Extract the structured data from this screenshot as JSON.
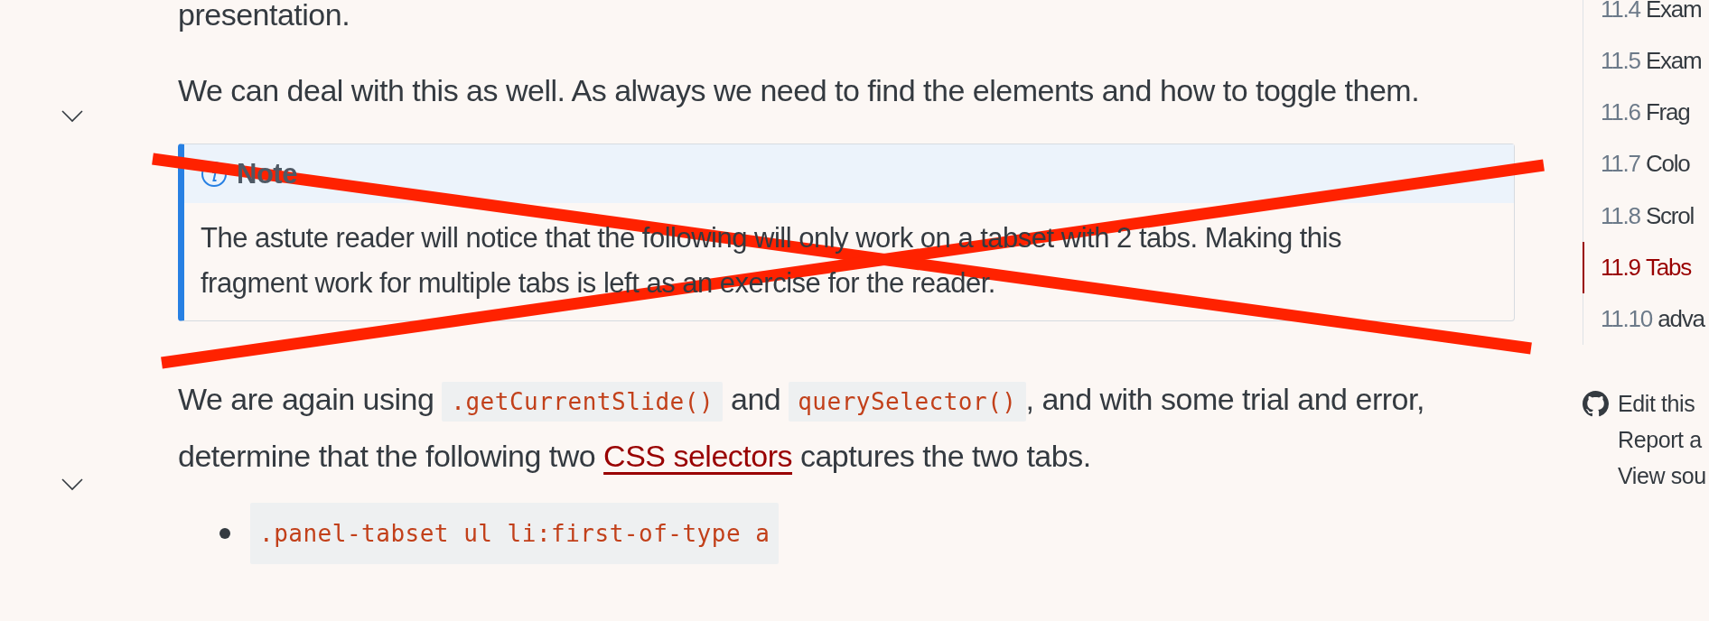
{
  "content": {
    "intro_fragment": "presentation.",
    "paragraph_1": "We can deal with this as well. As always we need to find the elements and how to toggle them.",
    "note": {
      "title": "Note",
      "body": "The astute reader will notice that the following will only work on a tabset with 2 tabs. Making this fragment work for multiple tabs is left as an exercise for the reader.",
      "crossed_out": true
    },
    "paragraph_2": [
      {
        "kind": "text",
        "text": "We are again using "
      },
      {
        "kind": "code",
        "text": ".getCurrentSlide()"
      },
      {
        "kind": "text",
        "text": " and "
      },
      {
        "kind": "code",
        "text": "querySelector()"
      },
      {
        "kind": "text",
        "text": ", and with some trial and error, determine that the following two "
      },
      {
        "kind": "link",
        "text": "CSS selectors"
      },
      {
        "kind": "text",
        "text": " captures the two tabs."
      }
    ],
    "selectors": [
      ".panel-tabset ul li:first-of-type a"
    ]
  },
  "toc": [
    {
      "number": "11.4",
      "title": "Exam",
      "selected": false
    },
    {
      "number": "11.5",
      "title": "Exam",
      "selected": false
    },
    {
      "number": "11.6",
      "title": "Frag",
      "selected": false
    },
    {
      "number": "11.7",
      "title": "Colo",
      "selected": false
    },
    {
      "number": "11.8",
      "title": "Scrol",
      "selected": false
    },
    {
      "number": "11.9",
      "title": "Tabs",
      "selected": true
    },
    {
      "number": "11.10",
      "title": "adva",
      "selected": false
    }
  ],
  "page_links": [
    "Edit this",
    "Report a",
    "View sou"
  ]
}
